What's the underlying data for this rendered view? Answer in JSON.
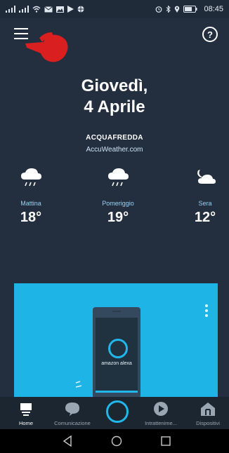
{
  "status_bar": {
    "time": "08:45"
  },
  "header": {
    "help_label": "?"
  },
  "weather": {
    "date_line1": "Giovedì,",
    "date_line2": "4 Aprile",
    "location": "ACQUAFREDDA",
    "provider": "AccuWeather.com",
    "forecast": [
      {
        "label": "Mattina",
        "temp": "18°",
        "icon": "cloud-rain-icon"
      },
      {
        "label": "Pomeriggio",
        "temp": "19°",
        "icon": "cloud-rain-icon"
      },
      {
        "label": "Sera",
        "temp": "12°",
        "icon": "cloudy-moon-icon"
      }
    ]
  },
  "card": {
    "phone_text": "amazon alexa"
  },
  "bottom_nav": {
    "home": "Home",
    "communication": "Comunicazione",
    "entertainment": "Intrattenime...",
    "devices": "Dispositivi"
  },
  "colors": {
    "background": "#232f3e",
    "accent": "#22b7ea",
    "card": "#1fb4e6"
  }
}
